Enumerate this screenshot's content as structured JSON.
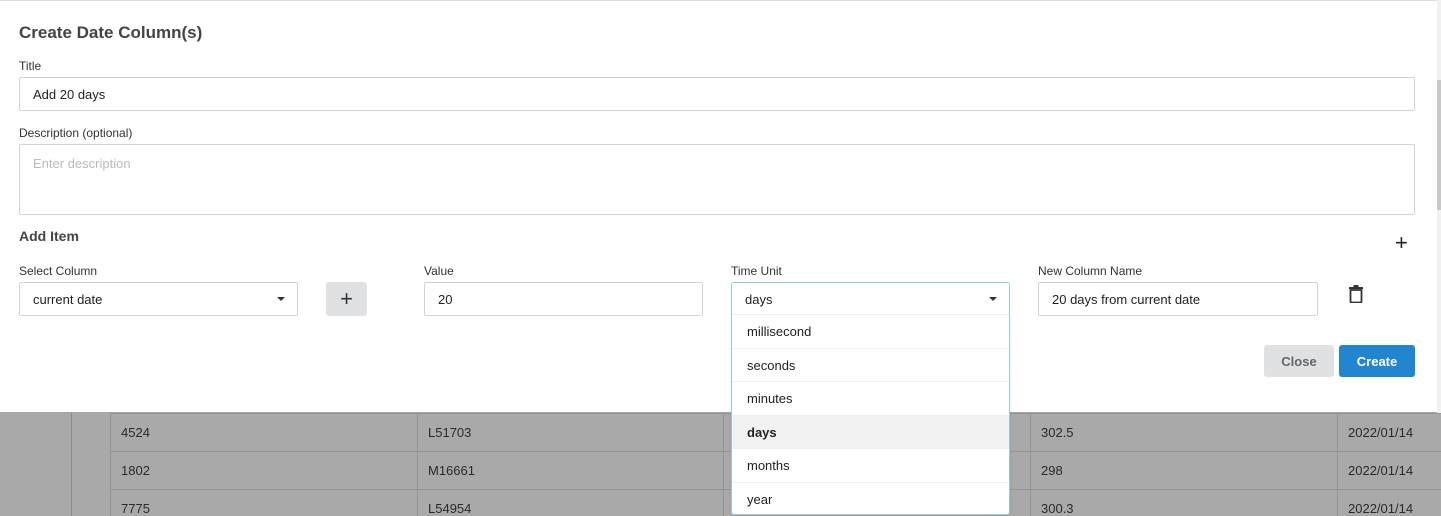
{
  "modal": {
    "title": "Create Date Column(s)",
    "title_field": {
      "label": "Title",
      "value": "Add 20 days"
    },
    "description_field": {
      "label": "Description (optional)",
      "placeholder": "Enter description"
    },
    "add_item_label": "Add Item",
    "select_column": {
      "label": "Select Column",
      "value": "current date"
    },
    "value_field": {
      "label": "Value",
      "value": "20"
    },
    "time_unit": {
      "label": "Time Unit",
      "value": "days",
      "options": [
        "millisecond",
        "seconds",
        "minutes",
        "days",
        "months",
        "year"
      ],
      "selected": "days"
    },
    "new_column_name": {
      "label": "New Column Name",
      "value": "20 days from current date"
    },
    "close_label": "Close",
    "create_label": "Create"
  },
  "colors": {
    "primary": "#2185d0",
    "secondary": "#e0e1e2"
  },
  "background_table": {
    "rows": [
      [
        "4524",
        "L51703",
        "",
        "302.5",
        "2022/01/14"
      ],
      [
        "1802",
        "M16661",
        "",
        "298",
        "2022/01/14"
      ],
      [
        "7775",
        "L54954",
        "",
        "300.3",
        "2022/01/14"
      ]
    ]
  }
}
